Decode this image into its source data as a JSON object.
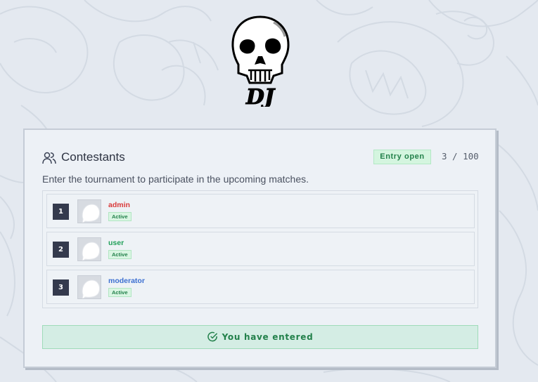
{
  "logo": {
    "text": "DJ"
  },
  "contestants": {
    "title": "Contestants",
    "entry_status": "Entry open",
    "count": "3 / 100",
    "description": "Enter the tournament to participate in the upcoming matches.",
    "rows": [
      {
        "rank": "1",
        "username": "admin",
        "name_color": "#d93a3a",
        "status": "Active"
      },
      {
        "rank": "2",
        "username": "user",
        "name_color": "#22a05a",
        "status": "Active"
      },
      {
        "rank": "3",
        "username": "moderator",
        "name_color": "#3c6fd1",
        "status": "Active"
      }
    ],
    "entered_label": "You have entered"
  },
  "colors": {
    "accent_green": "#22804a",
    "rank_badge": "#343a4d",
    "page_background": "#e4e9f0"
  }
}
